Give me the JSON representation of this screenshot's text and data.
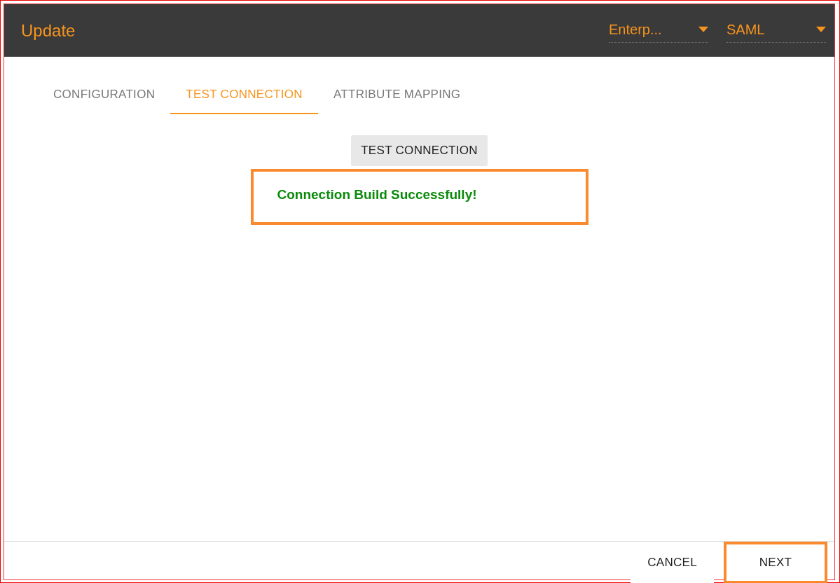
{
  "header": {
    "title": "Update",
    "dropdowns": [
      {
        "value": "Enterp..."
      },
      {
        "value": "SAML"
      }
    ]
  },
  "tabs": [
    {
      "label": "CONFIGURATION",
      "selected": false
    },
    {
      "label": "TEST CONNECTION",
      "selected": true
    },
    {
      "label": "ATTRIBUTE MAPPING",
      "selected": false
    }
  ],
  "test_button": {
    "label": "TEST CONNECTION"
  },
  "result": {
    "message": "Connection Build Successfully!",
    "highlighted": true
  },
  "footer": {
    "buttons": [
      {
        "label": "CANCEL",
        "highlighted": false
      },
      {
        "label": "NEXT",
        "highlighted": true
      }
    ]
  }
}
